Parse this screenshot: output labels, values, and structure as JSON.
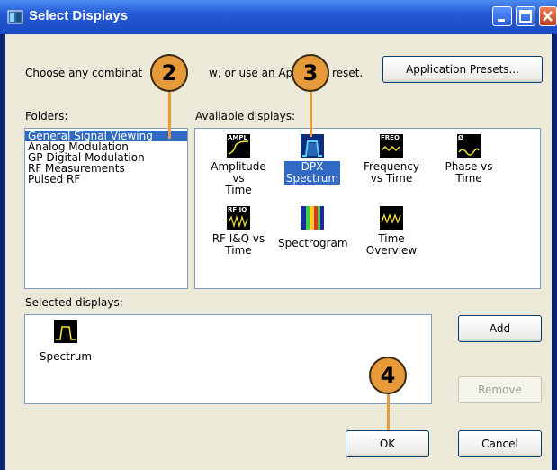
{
  "window": {
    "title": "Select Displays"
  },
  "instructions": "Choose any combinat",
  "instructions_mid": "w, or use an App",
  "instructions_end": "reset.",
  "presets_button": "Application Presets...",
  "folders": {
    "label": "Folders:",
    "items": [
      "General Signal Viewing",
      "Analog Modulation",
      "GP Digital Modulation",
      "RF Measurements",
      "Pulsed RF"
    ],
    "selected_index": 0
  },
  "available": {
    "label": "Available displays:",
    "items": [
      {
        "label1": "Amplitude vs",
        "label2": "Time",
        "icon": "ampl-icon",
        "icon_text": "AMPL"
      },
      {
        "label1": "DPX",
        "label2": "Spectrum",
        "icon": "dpx-spectrum-icon",
        "icon_text": ""
      },
      {
        "label1": "Frequency",
        "label2": "vs Time",
        "icon": "freq-icon",
        "icon_text": "FREQ"
      },
      {
        "label1": "Phase vs",
        "label2": "Time",
        "icon": "phase-icon",
        "icon_text": "Ø"
      },
      {
        "label1": "RF I&Q vs",
        "label2": "Time",
        "icon": "rf-iq-icon",
        "icon_text": "RF IQ"
      },
      {
        "label1": "Spectrogram",
        "label2": "",
        "icon": "spectrogram-icon",
        "icon_text": ""
      },
      {
        "label1": "Time",
        "label2": "Overview",
        "icon": "time-overview-icon",
        "icon_text": ""
      }
    ],
    "selected_index": 1
  },
  "selected": {
    "label": "Selected displays:",
    "items": [
      {
        "label": "Spectrum",
        "icon": "spectrum-icon"
      }
    ]
  },
  "buttons": {
    "add": "Add",
    "remove": "Remove",
    "ok": "OK",
    "cancel": "Cancel"
  },
  "callouts": [
    "2",
    "3",
    "4"
  ],
  "colors": {
    "callout": "#e79a3a",
    "selection": "#316ac5",
    "dialog_bg": "#ece9d8"
  }
}
